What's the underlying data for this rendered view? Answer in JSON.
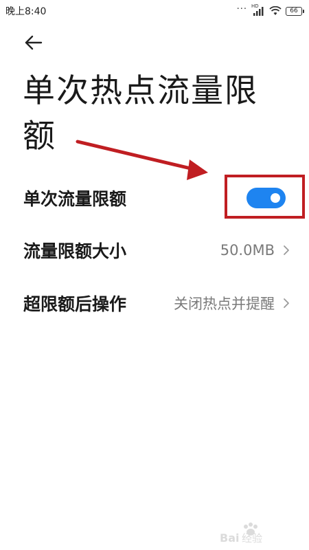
{
  "status_bar": {
    "time": "晚上8:40",
    "network_badge": "HD",
    "battery": "66",
    "icons": [
      "signal-icon",
      "wifi-icon",
      "battery-icon"
    ]
  },
  "header": {
    "back_icon": "arrow-left-icon",
    "title": "单次热点流量限额"
  },
  "settings": {
    "limit_toggle": {
      "label": "单次流量限额",
      "enabled": true
    },
    "limit_size": {
      "label": "流量限额大小",
      "value": "50.0MB"
    },
    "over_limit_action": {
      "label": "超限额后操作",
      "value": "关闭热点并提醒"
    }
  },
  "annotation": {
    "color": "#c01e22"
  },
  "colors": {
    "accent": "#1e84f0",
    "text_primary": "#1a1a1a",
    "text_secondary": "#7a7a7a"
  },
  "watermark": {
    "text": "Bai经验"
  }
}
